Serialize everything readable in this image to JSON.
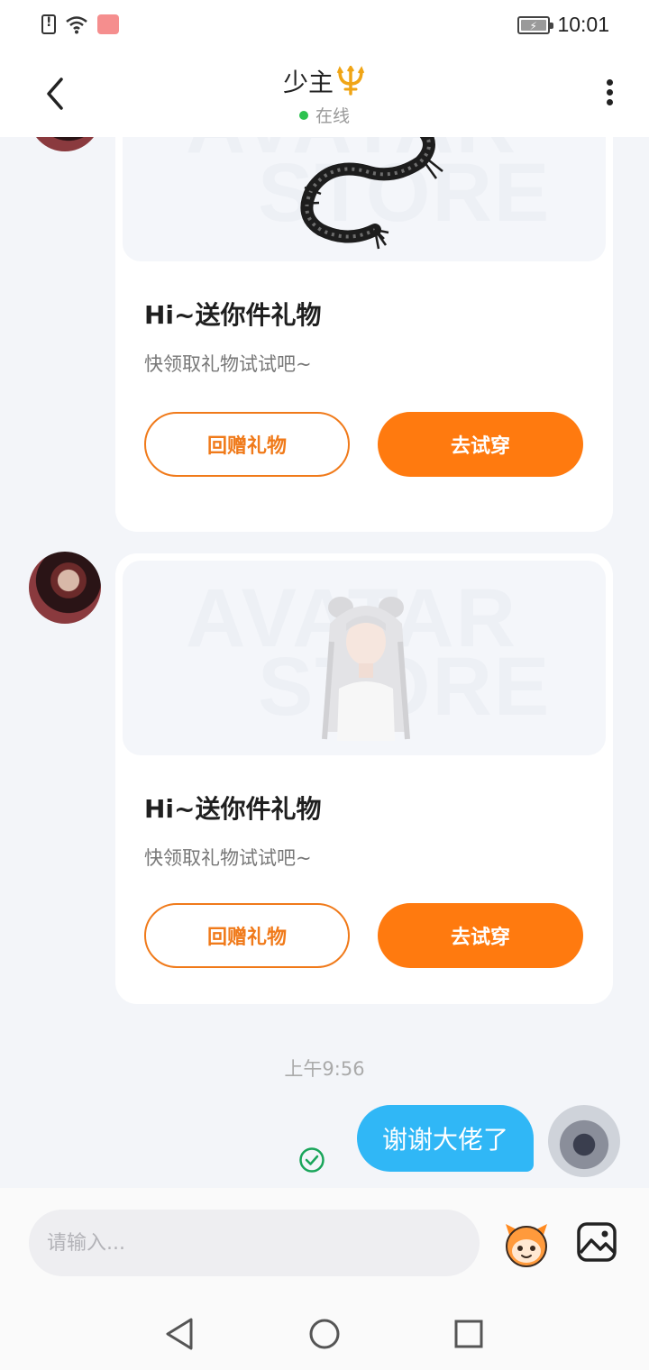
{
  "status_bar": {
    "time": "10:01",
    "icons": [
      "sim-alert-icon",
      "wifi-icon",
      "app-notification-icon",
      "battery-charging-icon"
    ]
  },
  "header": {
    "title": "少主",
    "title_emoji": "trident-icon",
    "status": "在线",
    "status_color": "#2dc24f"
  },
  "messages": [
    {
      "type": "gift",
      "side": "received",
      "gift_title": "Hi~送你件礼物",
      "gift_desc": "快领取礼物试试吧~",
      "watermark": [
        "AVATAR",
        "STORE"
      ],
      "item": "dragon-tattoo",
      "return_gift_label": "回赠礼物",
      "try_on_label": "去试穿"
    },
    {
      "type": "gift",
      "side": "received",
      "gift_title": "Hi~送你件礼物",
      "gift_desc": "快领取礼物试试吧~",
      "watermark": [
        "AVATAR",
        "STORE"
      ],
      "item": "white-hair-avatar",
      "return_gift_label": "回赠礼物",
      "try_on_label": "去试穿"
    }
  ],
  "timestamp": "上午9:56",
  "sent_message": {
    "text": "谢谢大佬了",
    "status_icon": "read-check-icon"
  },
  "input": {
    "placeholder": "请输入...",
    "value": ""
  },
  "colors": {
    "accent_orange": "#ff7a0f",
    "bubble_blue": "#30b7f6",
    "background": "#f3f5f9"
  },
  "nav": [
    "back-nav-icon",
    "home-nav-icon",
    "recents-nav-icon"
  ]
}
